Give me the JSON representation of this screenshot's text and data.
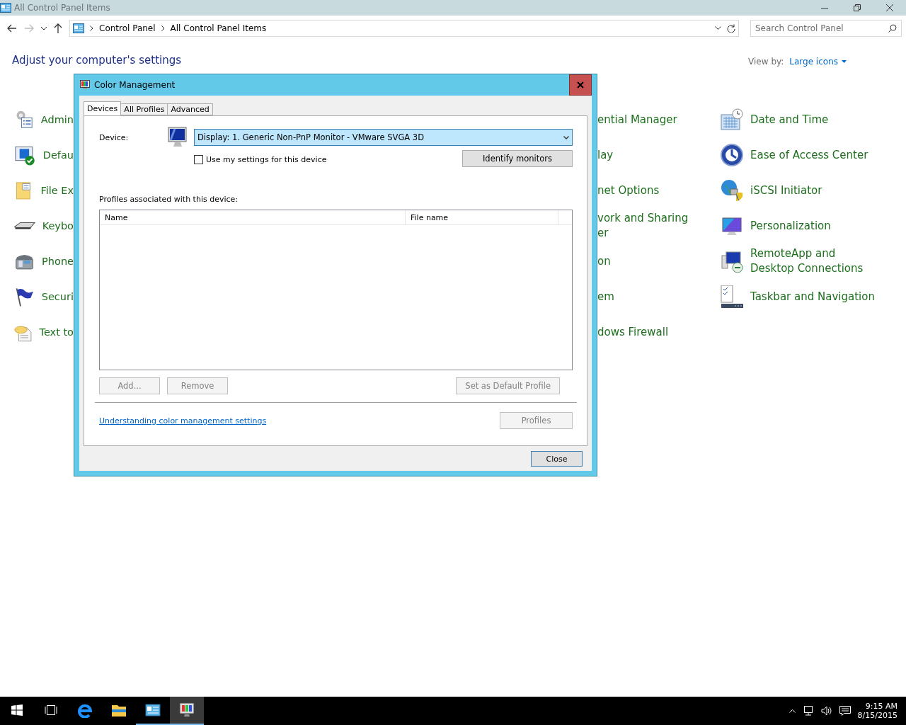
{
  "window": {
    "title": "All Control Panel Items"
  },
  "address_bar": {
    "crumbs": [
      "Control Panel",
      "All Control Panel Items"
    ]
  },
  "search": {
    "placeholder": "Search Control Panel"
  },
  "heading": "Adjust your computer's settings",
  "view_by": {
    "label": "View by:",
    "value": "Large icons"
  },
  "items_left": [
    "Admin",
    "Defau",
    "File Ex",
    "Keybo",
    "Phone",
    "Securi",
    "Text to"
  ],
  "items_middle": [
    "ential Manager",
    "lay",
    "net Options",
    "vork and Sharing\ner",
    "on",
    "em",
    "dows Firewall"
  ],
  "items_right": [
    "Date and Time",
    "Ease of Access Center",
    "iSCSI Initiator",
    "Personalization",
    "RemoteApp and Desktop Connections",
    "Taskbar and Navigation"
  ],
  "dialog": {
    "title": "Color Management",
    "tabs": [
      {
        "label": "Devices",
        "selected": true
      },
      {
        "label": "All Profiles",
        "selected": false
      },
      {
        "label": "Advanced",
        "selected": false
      }
    ],
    "device_label": "Device:",
    "device_value": "Display: 1. Generic Non-PnP Monitor - VMware SVGA 3D",
    "use_my_settings": {
      "label": "Use my settings for this device",
      "checked": false
    },
    "identify_button": "Identify monitors",
    "profiles_label": "Profiles associated with this device:",
    "columns": [
      "Name",
      "File name"
    ],
    "buttons": [
      {
        "label": "Add...",
        "disabled": true
      },
      {
        "label": "Remove",
        "disabled": true
      },
      {
        "label": "Set as Default Profile",
        "disabled": true
      }
    ],
    "link": "Understanding color management settings",
    "profiles_button": {
      "label": "Profiles",
      "disabled": true
    },
    "close_button": "Close"
  },
  "taskbar": {
    "apps": [
      {
        "open": false,
        "selected": false
      },
      {
        "open": false,
        "selected": false
      },
      {
        "open": true,
        "selected": false
      },
      {
        "open": true,
        "selected": true
      }
    ],
    "time": "9:15 AM",
    "date": "8/15/2015"
  }
}
